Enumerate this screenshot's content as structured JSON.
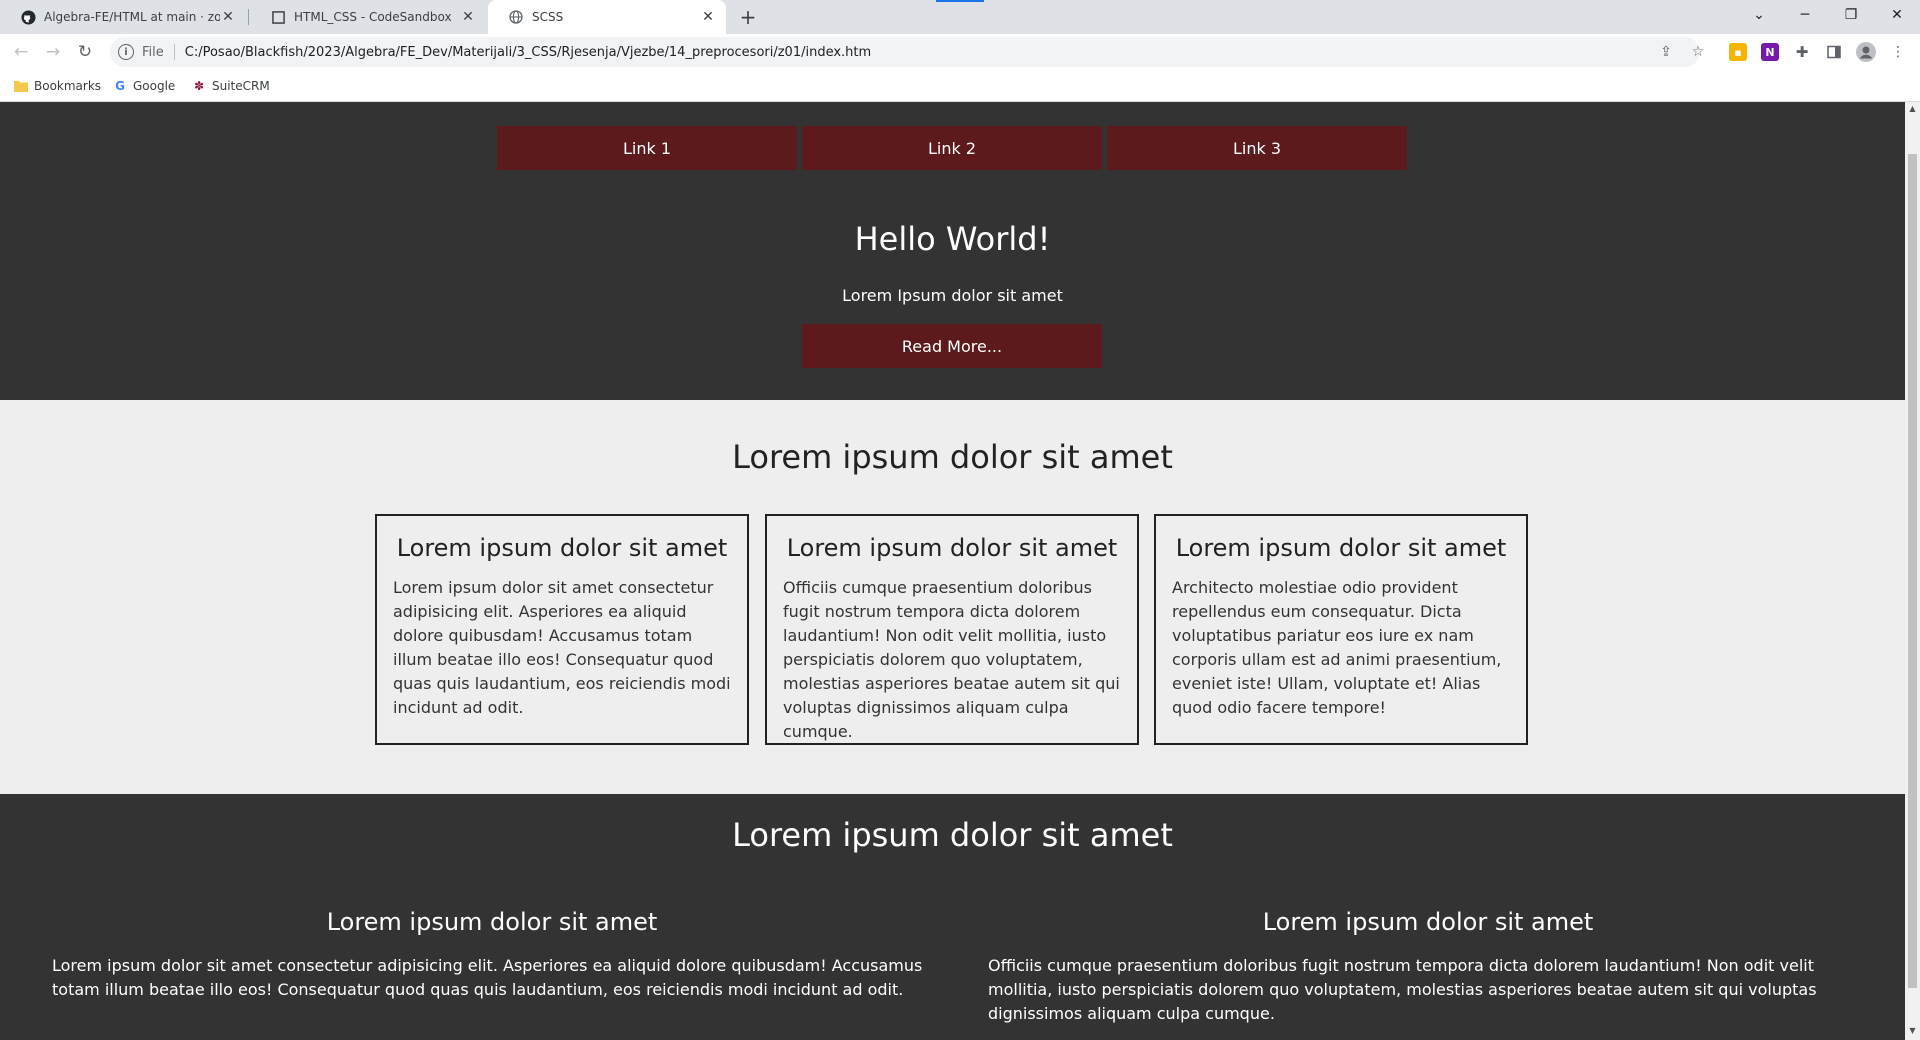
{
  "browser": {
    "tabs": [
      {
        "title": "Algebra-FE/HTML at main · zoris",
        "favicon": "github-icon",
        "active": false
      },
      {
        "title": "HTML_CSS - CodeSandbox",
        "favicon": "codesandbox-icon",
        "active": false
      },
      {
        "title": "SCSS",
        "favicon": "globe-icon",
        "active": true
      }
    ],
    "new_tab": "+",
    "address": {
      "chip": "File",
      "url": "C:/Posao/Blackfish/2023/Algebra/FE_Dev/Materijali/3_CSS/Rjesenja/Vjezbe/14_preprocesori/z01/index.htm"
    },
    "bookmarks": [
      {
        "label": "Bookmarks",
        "icon": "folder-icon"
      },
      {
        "label": "Google",
        "icon": "google-icon"
      },
      {
        "label": "SuiteCRM",
        "icon": "suitecrm-icon"
      }
    ],
    "colors": {
      "tabbar": "#dee1e6",
      "accent": "#1a73e8"
    }
  },
  "page": {
    "nav": {
      "links": [
        "Link 1",
        "Link 2",
        "Link 3"
      ]
    },
    "hero": {
      "title": "Hello World!",
      "subtitle": "Lorem Ipsum dolor sit amet",
      "button": "Read More..."
    },
    "features": {
      "title": "Lorem ipsum dolor sit amet",
      "cards": [
        {
          "title": "Lorem ipsum dolor sit amet",
          "text": "Lorem ipsum dolor sit amet consectetur adipisicing elit. Asperiores ea aliquid dolore quibusdam! Accusamus totam illum beatae illo eos! Consequatur quod quas quis laudantium, eos reiciendis modi incidunt ad odit."
        },
        {
          "title": "Lorem ipsum dolor sit amet",
          "text": "Officiis cumque praesentium doloribus fugit nostrum tempora dicta dolorem laudantium! Non odit velit mollitia, iusto perspiciatis dolorem quo voluptatem, molestias asperiores beatae autem sit qui voluptas dignissimos aliquam culpa cumque."
        },
        {
          "title": "Lorem ipsum dolor sit amet",
          "text": "Architecto molestiae odio provident repellendus eum consequatur. Dicta voluptatibus pariatur eos iure ex nam corporis ullam est ad animi praesentium, eveniet iste! Ullam, voluptate et! Alias quod odio facere tempore!"
        }
      ]
    },
    "bottom": {
      "title": "Lorem ipsum dolor sit amet",
      "columns": [
        {
          "title": "Lorem ipsum dolor sit amet",
          "text": "Lorem ipsum dolor sit amet consectetur adipisicing elit. Asperiores ea aliquid dolore quibusdam! Accusamus totam illum beatae illo eos! Consequatur quod quas quis laudantium, eos reiciendis modi incidunt ad odit."
        },
        {
          "title": "Lorem ipsum dolor sit amet",
          "text": "Officiis cumque praesentium doloribus fugit nostrum tempora dicta dolorem laudantium! Non odit velit mollitia, iusto perspiciatis dolorem quo voluptatem, molestias asperiores beatae autem sit qui voluptas dignissimos aliquam culpa cumque."
        }
      ]
    },
    "colors": {
      "dark_bg": "#333333",
      "light_bg": "#eeeeee",
      "button": "#5c1a1d"
    }
  }
}
